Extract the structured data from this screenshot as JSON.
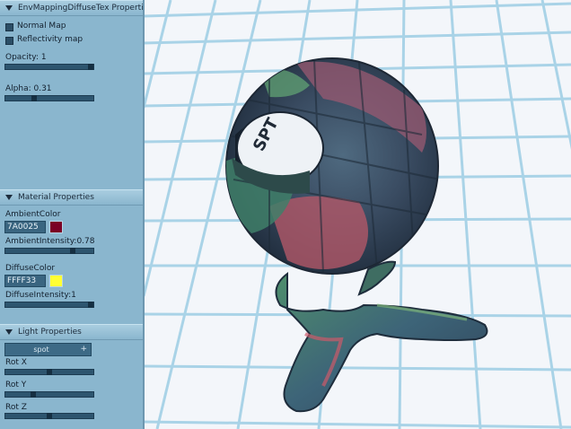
{
  "panel": {
    "title": "EnvMappingDiffuseTex Propertie",
    "normal_map_label": "Normal Map",
    "reflectivity_label": "Reflectivity map",
    "opacity_label": "Opacity: 1",
    "opacity_value": 1,
    "alpha_label": "Alpha: 0.31",
    "alpha_value": 0.31
  },
  "material": {
    "header": "Material Properties",
    "ambient_color_label": "AmbientColor",
    "ambient_color_value": "7A0025",
    "ambient_swatch": "#7a0025",
    "ambient_intensity_label": "AmbientIntensity:0.78",
    "ambient_intensity_value": 0.78,
    "diffuse_color_label": "DiffuseColor",
    "diffuse_color_value": "FFFF33",
    "diffuse_swatch": "#ffff33",
    "diffuse_intensity_label": "DiffuseIntensity:1",
    "diffuse_intensity_value": 1
  },
  "light": {
    "header": "Light Properties",
    "type_value": "spot",
    "type_button": "+",
    "rot_x_label": "Rot X",
    "rot_x_value": 0.5,
    "rot_y_label": "Rot Y",
    "rot_y_value": 0.3,
    "rot_z_label": "Rot Z",
    "rot_z_value": 0.5
  },
  "colors": {
    "panel_bg": "#8ab6ce",
    "grid_line": "#a7d2e6",
    "floor_bg": "#f3f6fa"
  }
}
